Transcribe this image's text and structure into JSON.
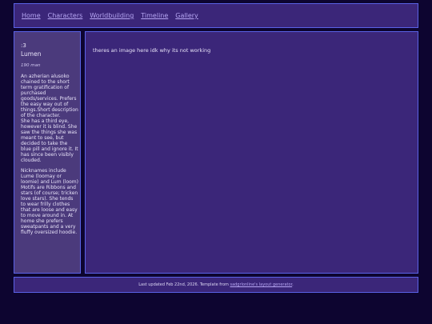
{
  "nav": {
    "links": [
      "Home",
      "Characters",
      "Worldbuilding",
      "Timeline",
      "Gallery"
    ]
  },
  "sidebar": {
    "emoticon": ":3",
    "name": "Lumen",
    "meta": "190 man",
    "bio": "An azherian alusoko chained to the short term gratification of purchased goods/services. Prefers the easy way out of things.Short description of the character.\nShe has a third eye, however it is blind. She saw the things she was meant to see, but decided to take the blue pill and ignore it. It has since been visibly clouded.",
    "notes": "Nicknames include Lume (loomay or loomie) and Lum (loom)\nMotifs are Ribbons and stars (of course; tricken love stars). She tends to wear frilly clothes that are loose and easy to move around in. At home she prefers sweatpants and a very fluffy oversized hoodie."
  },
  "main": {
    "message": "theres an image here idk why its not working"
  },
  "footer": {
    "prefix": "Last updated Feb 22nd, 2026. Template from ",
    "link_text": "sadgrlonline's layout generator",
    "suffix": "."
  }
}
